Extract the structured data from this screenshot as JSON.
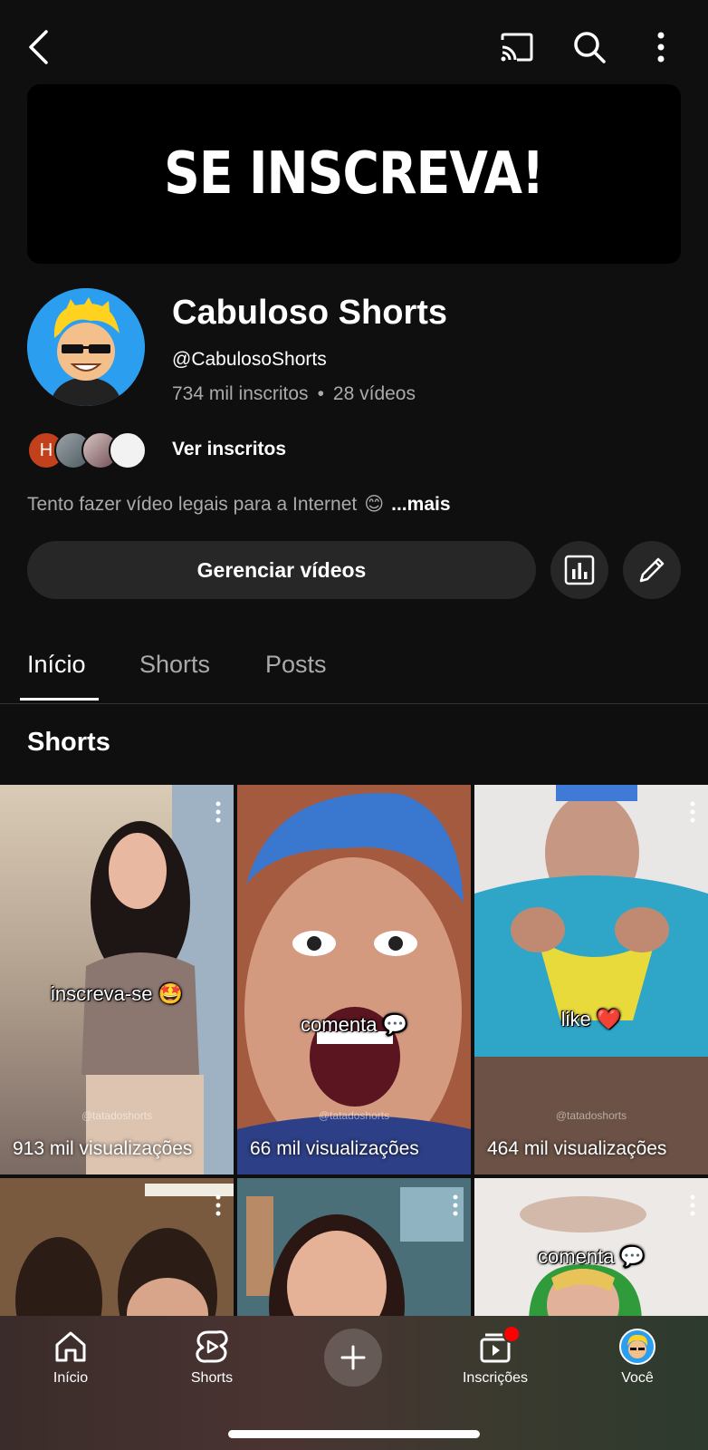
{
  "banner": {
    "text": "SE INSCREVA!"
  },
  "channel": {
    "name": "Cabuloso Shorts",
    "handle": "@CabulosoShorts",
    "subscribers": "734 mil inscritos",
    "separator": "•",
    "videos": "28 vídeos"
  },
  "subscribers_preview": {
    "initial": "H",
    "label": "Ver inscritos"
  },
  "description": {
    "text": "Tento fazer vídeo legais para a Internet",
    "emoji": "😊",
    "more": "...mais"
  },
  "actions": {
    "manage_label": "Gerenciar vídeos"
  },
  "tabs": [
    {
      "label": "Início",
      "active": true
    },
    {
      "label": "Shorts",
      "active": false
    },
    {
      "label": "Posts",
      "active": false
    }
  ],
  "section": {
    "title": "Shorts"
  },
  "shorts": [
    {
      "caption": "inscreva-se 🤩",
      "watermark": "@tatadoshorts",
      "views": "913 mil visualizações"
    },
    {
      "caption": "comenta 💬",
      "watermark": "@tatadoshorts",
      "views": "66 mil visualizações"
    },
    {
      "caption": "like ❤️",
      "watermark": "@tatadoshorts",
      "views": "464 mil visualizações"
    },
    {
      "caption": "",
      "views": ""
    },
    {
      "caption": "",
      "views": ""
    },
    {
      "caption": "comenta 💬",
      "views": ""
    }
  ],
  "bottom_nav": [
    {
      "label": "Início",
      "icon": "home-icon"
    },
    {
      "label": "Shorts",
      "icon": "shorts-icon"
    },
    {
      "label": "",
      "icon": "plus-icon"
    },
    {
      "label": "Inscrições",
      "icon": "subscriptions-icon"
    },
    {
      "label": "Você",
      "icon": "avatar"
    }
  ],
  "colors": {
    "background": "#0f0f0f",
    "button": "#272727",
    "muted_text": "#aaaaaa",
    "notification": "#ff0000"
  }
}
